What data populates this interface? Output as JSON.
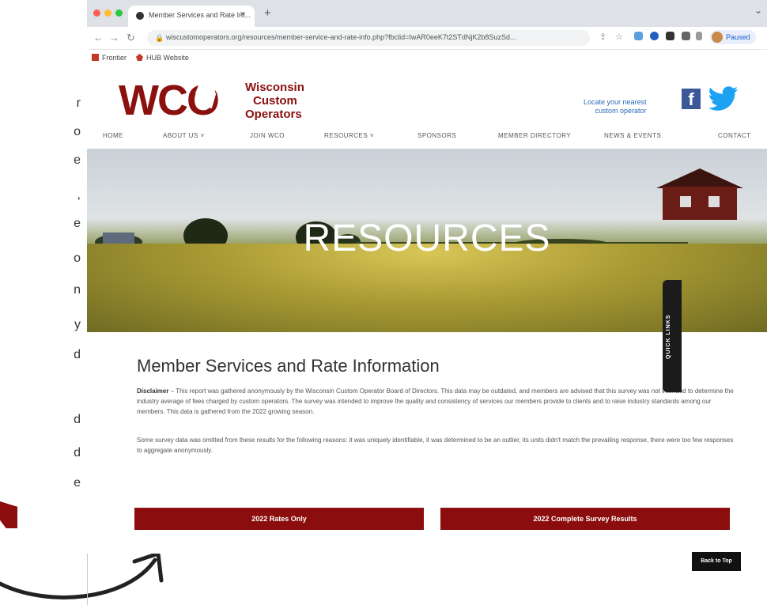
{
  "left_fragments": [
    "r",
    "o",
    "e",
    ",",
    "e",
    "o",
    "n",
    "y",
    "d",
    "d",
    "d",
    "e"
  ],
  "browser": {
    "tab_title": "Member Services and Rate Inf...",
    "url": "wiscustomoperators.org/resources/member-service-and-rate-info.php?fbclid=IwAR0eeK7t2STdNjK2b8SuzSd...",
    "profile_label": "Paused",
    "bookmarks": [
      "Frontier",
      "HUB Website"
    ]
  },
  "site": {
    "logo_letters": "WCO",
    "logo_words": [
      "Wisconsin",
      "Custom",
      "Operators"
    ],
    "locate_text": [
      "Locate your nearest",
      "custom operator"
    ],
    "nav": [
      "HOME",
      "ABOUT US ˅",
      "JOIN WCO",
      "RESOURCES ˅",
      "SPONSORS",
      "MEMBER DIRECTORY",
      "NEWS & EVENTS",
      "CONTACT"
    ],
    "hero_title": "RESOURCES",
    "quick_links": "QUICK LINKS",
    "page_heading": "Member Services and Rate Information",
    "disclaimer_label": "Disclaimer",
    "disclaimer_text": " – This report was gathered anonymously by the Wisconsin Custom Operator Board of Directors. This data may be outdated, and members are advised that this survey was not intended to determine the industry average of fees charged by custom operators. The survey was intended to improve the quality and consistency of services our members provide to clients and to raise industry standards among our members. This data is gathered from the 2022 growing season.",
    "omitted_text": "Some survey data was omitted from these results for the following reasons: it was uniquely identifiable, it was determined to be an outlier, its units didn't match the prevailing response, there were too few responses to aggregate anonymously.",
    "button_rates": "2022 Rates Only",
    "button_complete": "2022 Complete Survey Results",
    "back_to_top": "Back to Top"
  }
}
